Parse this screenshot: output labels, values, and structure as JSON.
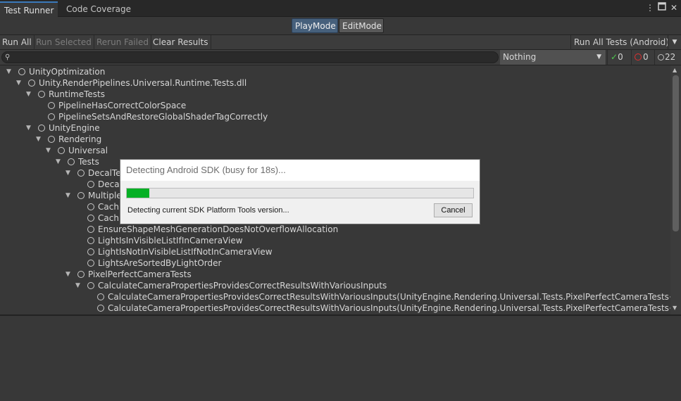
{
  "tabs": [
    {
      "label": "Test Runner",
      "active": true
    },
    {
      "label": "Code Coverage",
      "active": false
    }
  ],
  "window_controls": [
    "more-icon",
    "maximize-icon",
    "close-icon"
  ],
  "modes": {
    "play": "PlayMode",
    "edit": "EditMode",
    "selected": "PlayMode"
  },
  "toolbar": {
    "run_all": "Run All",
    "run_selected": "Run Selected",
    "rerun_failed": "Rerun Failed",
    "clear_results": "Clear Results",
    "run_all_target": "Run All Tests (Android)"
  },
  "filter": {
    "search_value": "",
    "category": "Nothing",
    "passed_count": "0",
    "failed_count": "0",
    "not_run_count": "22"
  },
  "tree": [
    {
      "depth": 0,
      "expanded": true,
      "label": "UnityOptimization"
    },
    {
      "depth": 1,
      "expanded": true,
      "label": "Unity.RenderPipelines.Universal.Runtime.Tests.dll"
    },
    {
      "depth": 2,
      "expanded": true,
      "label": "RuntimeTests"
    },
    {
      "depth": 3,
      "expanded": null,
      "label": "PipelineHasCorrectColorSpace"
    },
    {
      "depth": 3,
      "expanded": null,
      "label": "PipelineSetsAndRestoreGlobalShaderTagCorrectly"
    },
    {
      "depth": 2,
      "expanded": true,
      "label": "UnityEngine"
    },
    {
      "depth": 3,
      "expanded": true,
      "label": "Rendering"
    },
    {
      "depth": 4,
      "expanded": true,
      "label": "Universal"
    },
    {
      "depth": 5,
      "expanded": true,
      "label": "Tests"
    },
    {
      "depth": 6,
      "expanded": true,
      "label": "DecalTe"
    },
    {
      "depth": 7,
      "expanded": null,
      "label": "Deca"
    },
    {
      "depth": 6,
      "expanded": true,
      "label": "Multiple"
    },
    {
      "depth": 7,
      "expanded": null,
      "label": "Cach"
    },
    {
      "depth": 7,
      "expanded": null,
      "label": "Cach"
    },
    {
      "depth": 7,
      "expanded": null,
      "label": "EnsureShapeMeshGenerationDoesNotOverflowAllocation"
    },
    {
      "depth": 7,
      "expanded": null,
      "label": "LightIsInVisibleListIfInCameraView"
    },
    {
      "depth": 7,
      "expanded": null,
      "label": "LightIsNotInVisibleListIfNotInCameraView"
    },
    {
      "depth": 7,
      "expanded": null,
      "label": "LightsAreSortedByLightOrder"
    },
    {
      "depth": 6,
      "expanded": true,
      "label": "PixelPerfectCameraTests"
    },
    {
      "depth": 7,
      "expanded": true,
      "label": "CalculateCameraPropertiesProvidesCorrectResultsWithVariousInputs"
    },
    {
      "depth": 8,
      "expanded": null,
      "label": "CalculateCameraPropertiesProvidesCorrectResultsWithVariousInputs(UnityEngine.Rendering.Universal.Tests.PixelPerfectCameraTests+PixelP"
    },
    {
      "depth": 8,
      "expanded": null,
      "label": "CalculateCameraPropertiesProvidesCorrectResultsWithVariousInputs(UnityEngine.Rendering.Universal.Tests.PixelPerfectCameraTests+PixelP"
    }
  ],
  "dialog": {
    "title": "Detecting Android SDK (busy for 18s)...",
    "progress_fraction": 0.065,
    "message": "Detecting current SDK Platform Tools version...",
    "cancel_label": "Cancel",
    "progress_color": "#06b025"
  },
  "colors": {
    "accent": "#3a79bb",
    "mode_active": "#46607c",
    "passed": "#4cc84c",
    "failed": "#e03030"
  }
}
